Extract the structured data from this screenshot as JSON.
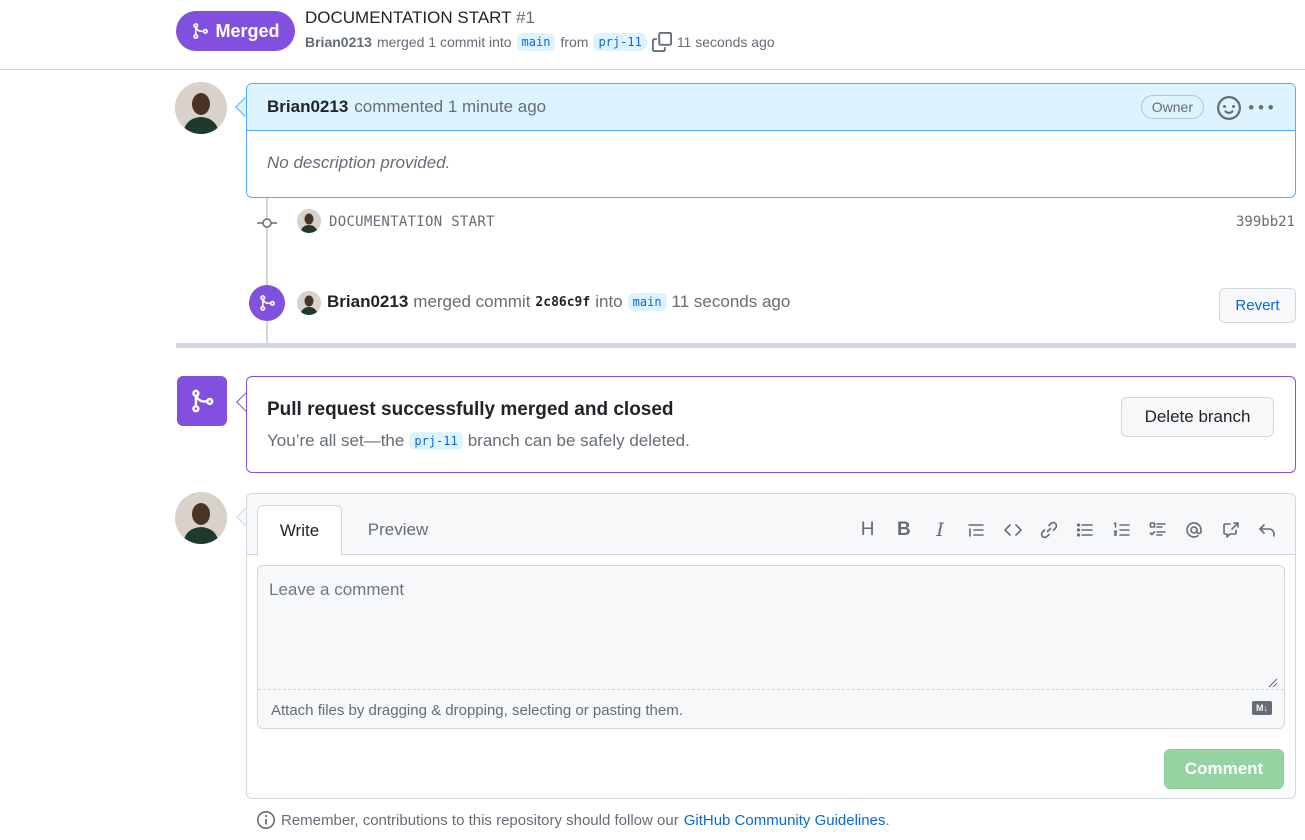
{
  "header": {
    "status": "Merged",
    "title": "DOCUMENTATION START",
    "number": "#1",
    "author": "Brian0213",
    "merged_text": "merged 1 commit into",
    "base_branch": "main",
    "from_text": "from",
    "head_branch": "prj-11",
    "time": "11 seconds ago"
  },
  "comment": {
    "author": "Brian0213",
    "action": "commented 1 minute ago",
    "role": "Owner",
    "body": "No description provided."
  },
  "commit": {
    "message": "DOCUMENTATION START",
    "sha": "399bb21"
  },
  "merge_event": {
    "author": "Brian0213",
    "text": "merged commit",
    "sha": "2c86c9f",
    "into": "into",
    "branch": "main",
    "time": "11 seconds ago",
    "revert_label": "Revert"
  },
  "merge_status": {
    "title": "Pull request successfully merged and closed",
    "sub_prefix": "You’re all set—the",
    "branch": "prj-11",
    "sub_suffix": "branch can be safely deleted.",
    "delete_label": "Delete branch"
  },
  "new_comment": {
    "tab_write": "Write",
    "tab_preview": "Preview",
    "placeholder": "Leave a comment",
    "attach_text": "Attach files by dragging & dropping, selecting or pasting them.",
    "md_badge": "M↓",
    "submit_label": "Comment",
    "toolbar": [
      "heading-icon",
      "bold-icon",
      "italic-icon",
      "quote-icon",
      "code-icon",
      "link-icon",
      "bulleted-list-icon",
      "numbered-list-icon",
      "task-list-icon",
      "mention-icon",
      "cross-reference-icon",
      "saved-reply-icon"
    ]
  },
  "footer": {
    "text": "Remember, contributions to this repository should follow our",
    "link": "GitHub Community Guidelines",
    "end": "."
  },
  "colors": {
    "merged_purple": "#8250df",
    "link_blue": "#0969da",
    "comment_header_bg": "#ddf4ff",
    "comment_button_disabled": "#94d3a2"
  }
}
